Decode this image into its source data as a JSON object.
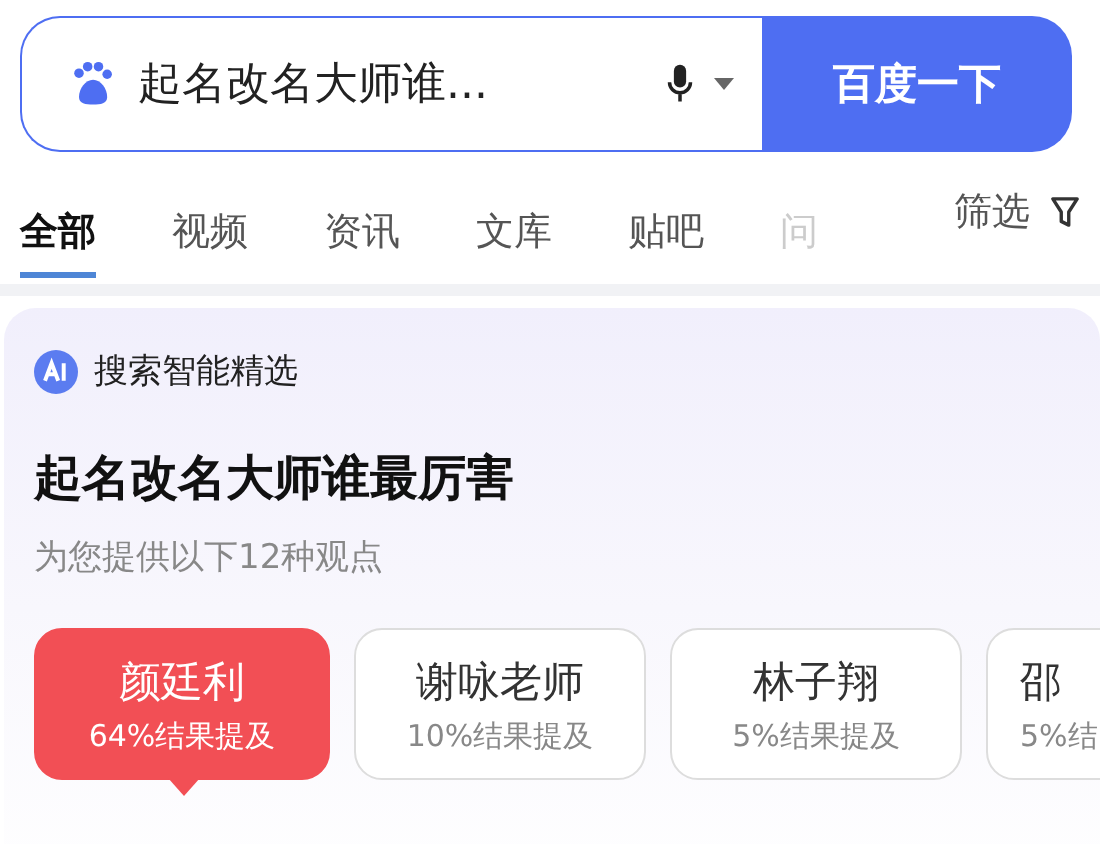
{
  "search": {
    "value": "起名改名大师谁...",
    "button": "百度一下"
  },
  "tabs": [
    {
      "label": "全部",
      "selected": true
    },
    {
      "label": "视频",
      "selected": false
    },
    {
      "label": "资讯",
      "selected": false
    },
    {
      "label": "文库",
      "selected": false
    },
    {
      "label": "贴吧",
      "selected": false
    },
    {
      "label": "问",
      "selected": false
    }
  ],
  "filter": "筛选",
  "ai_card": {
    "badge": "搜索智能精选",
    "title": "起名改名大师谁最厉害",
    "subtitle": "为您提供以下12种观点",
    "options": [
      {
        "name": "颜廷利",
        "share": "64%结果提及",
        "selected": true
      },
      {
        "name": "谢咏老师",
        "share": "10%结果提及",
        "selected": false
      },
      {
        "name": "林子翔",
        "share": "5%结果提及",
        "selected": false
      },
      {
        "name": "邵",
        "share": "5%结",
        "selected": false
      }
    ]
  }
}
